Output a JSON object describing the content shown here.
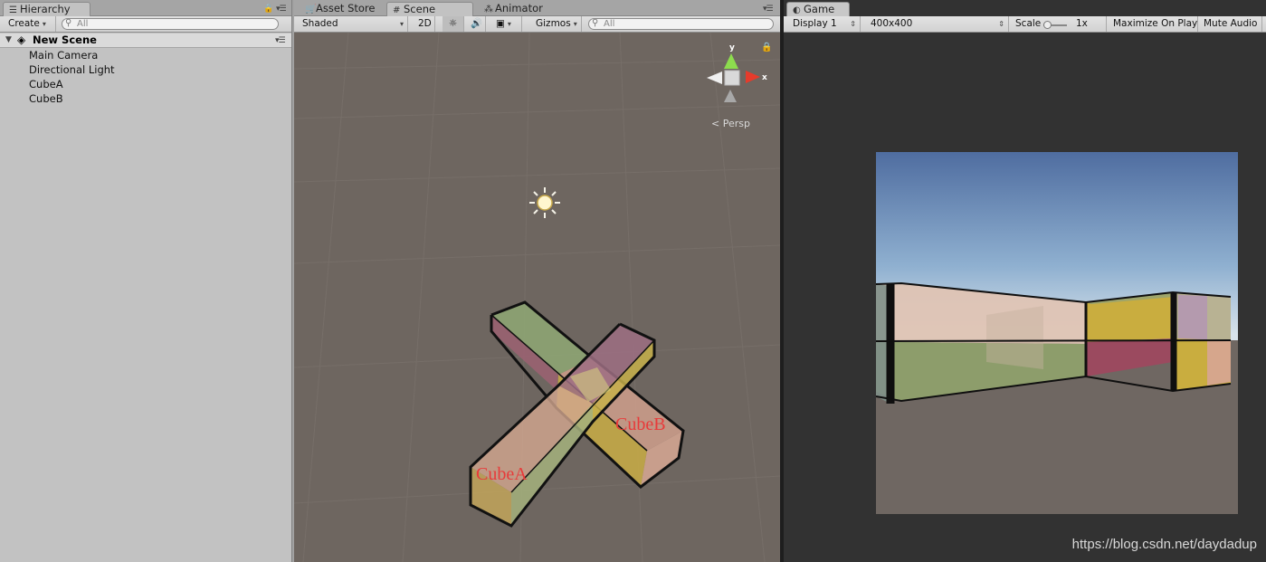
{
  "hierarchy": {
    "tab_label": "Hierarchy",
    "create_label": "Create",
    "search_placeholder": "All",
    "scene_name": "New Scene",
    "items": [
      {
        "label": "Main Camera"
      },
      {
        "label": "Directional Light"
      },
      {
        "label": "CubeA"
      },
      {
        "label": "CubeB"
      }
    ]
  },
  "scene": {
    "tabs": [
      {
        "label": "Asset Store",
        "icon": "shopping-cart-icon"
      },
      {
        "label": "Scene",
        "icon": "grid-icon"
      },
      {
        "label": "Animator",
        "icon": "nodes-icon"
      }
    ],
    "active_tab": "Scene",
    "draw_mode": "Shaded",
    "mode_2d": "2D",
    "gizmos_label": "Gizmos",
    "search_placeholder": "All",
    "projection_label": "Persp",
    "gizmo_axes": {
      "y": "y",
      "x": "x"
    },
    "object_labels": {
      "cube_a": "CubeA",
      "cube_b": "CubeB"
    }
  },
  "game": {
    "tab_label": "Game",
    "display": "Display 1",
    "resolution": "400x400",
    "scale_label": "Scale",
    "scale_value": "1x",
    "maximize_label": "Maximize On Play",
    "mute_label": "Mute Audio"
  },
  "watermark": "https://blog.csdn.net/daydadup",
  "colors": {
    "scene_bg": "#6e6660",
    "sky_top": "#4e6d9e",
    "sky_bottom": "#c9d7e3",
    "ground": "#6f6762",
    "label_red": "#e83a3a"
  }
}
